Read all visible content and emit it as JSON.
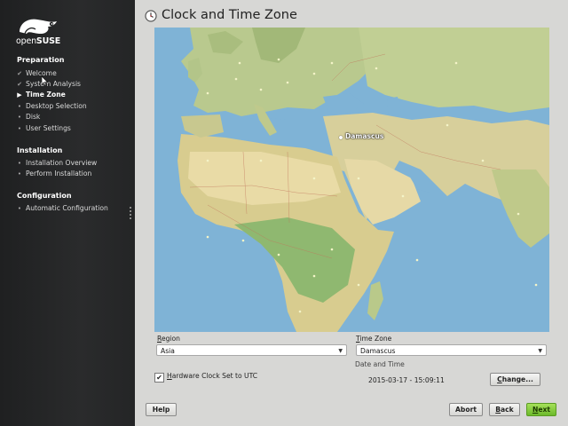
{
  "sidebar": {
    "logo_brand": "SUSE",
    "logo_prefix": "open",
    "sections": [
      {
        "title": "Preparation",
        "steps": [
          {
            "label": "Welcome",
            "state": "done"
          },
          {
            "label": "System Analysis",
            "state": "done"
          },
          {
            "label": "Time Zone",
            "state": "current"
          },
          {
            "label": "Desktop Selection",
            "state": "pending"
          },
          {
            "label": "Disk",
            "state": "pending"
          },
          {
            "label": "User Settings",
            "state": "pending"
          }
        ]
      },
      {
        "title": "Installation",
        "steps": [
          {
            "label": "Installation Overview",
            "state": "pending"
          },
          {
            "label": "Perform Installation",
            "state": "pending"
          }
        ]
      },
      {
        "title": "Configuration",
        "steps": [
          {
            "label": "Automatic Configuration",
            "state": "pending"
          }
        ]
      }
    ]
  },
  "page": {
    "title": "Clock and Time Zone",
    "title_icon": "clock-icon"
  },
  "map": {
    "selected_city": "Damascus"
  },
  "region": {
    "label_prefix": "R",
    "label_rest": "egion",
    "value": "Asia"
  },
  "timezone": {
    "label_prefix": "T",
    "label_rest": "ime Zone",
    "value": "Damascus"
  },
  "datetime": {
    "label": "Date and Time",
    "value": "2015-03-17 - 15:09:11"
  },
  "hardware_clock": {
    "label_prefix": "H",
    "label_rest": "ardware Clock Set to UTC",
    "checked": true
  },
  "buttons": {
    "change_prefix": "C",
    "change_rest": "hange...",
    "help": "Help",
    "abort": "Abort",
    "back_prefix": "B",
    "back_rest": "ack",
    "next_prefix": "N",
    "next_rest": "ext"
  },
  "colors": {
    "next_button": "#7cc53a",
    "sidebar_bg": "#252627",
    "ocean": "#7fb3d6"
  }
}
